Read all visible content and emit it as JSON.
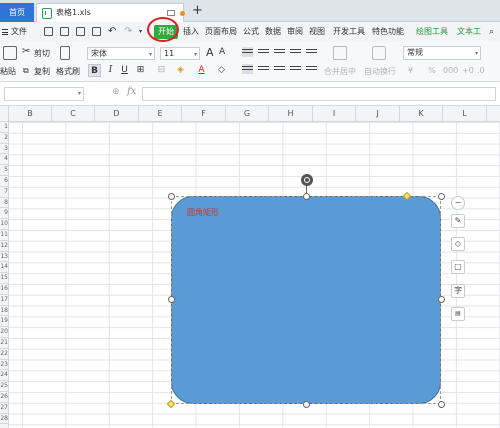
{
  "tabs": {
    "home": "首页",
    "document": "表格1.xls",
    "add": "+"
  },
  "menu": {
    "file": "文件",
    "start": "开始",
    "insert": "插入",
    "page_layout": "页面布局",
    "formula": "公式",
    "data": "数据",
    "review": "审阅",
    "view": "视图",
    "developer": "开发工具",
    "features": "特色功能",
    "drawing_tools": "绘图工具",
    "text_tools": "文本工"
  },
  "toolbar": {
    "paste": "粘贴",
    "cut": "剪切",
    "copy": "复制",
    "format_painter": "格式刷",
    "font_name": "宋体",
    "font_size": "11",
    "bold": "B",
    "italic": "I",
    "underline": "U",
    "merge_center": "合并居中",
    "wrap_text": "自动换行",
    "number_format": "常规",
    "percent": "%",
    "comma": "000"
  },
  "formula_bar": {
    "fx": "fx"
  },
  "columns": [
    "B",
    "C",
    "D",
    "E",
    "F",
    "G",
    "H",
    "I",
    "J",
    "K",
    "L"
  ],
  "rows": [
    "1",
    "2",
    "3",
    "4",
    "5",
    "6",
    "7",
    "8",
    "9",
    "10",
    "11",
    "12",
    "13",
    "14",
    "15",
    "16",
    "17",
    "18",
    "19",
    "20",
    "21",
    "22",
    "23",
    "24",
    "25",
    "26",
    "27",
    "28"
  ],
  "shape": {
    "label": "圆角矩形",
    "fill_color": "#5b9bd5"
  },
  "side_tools": {
    "minus": "−",
    "text": "字"
  }
}
